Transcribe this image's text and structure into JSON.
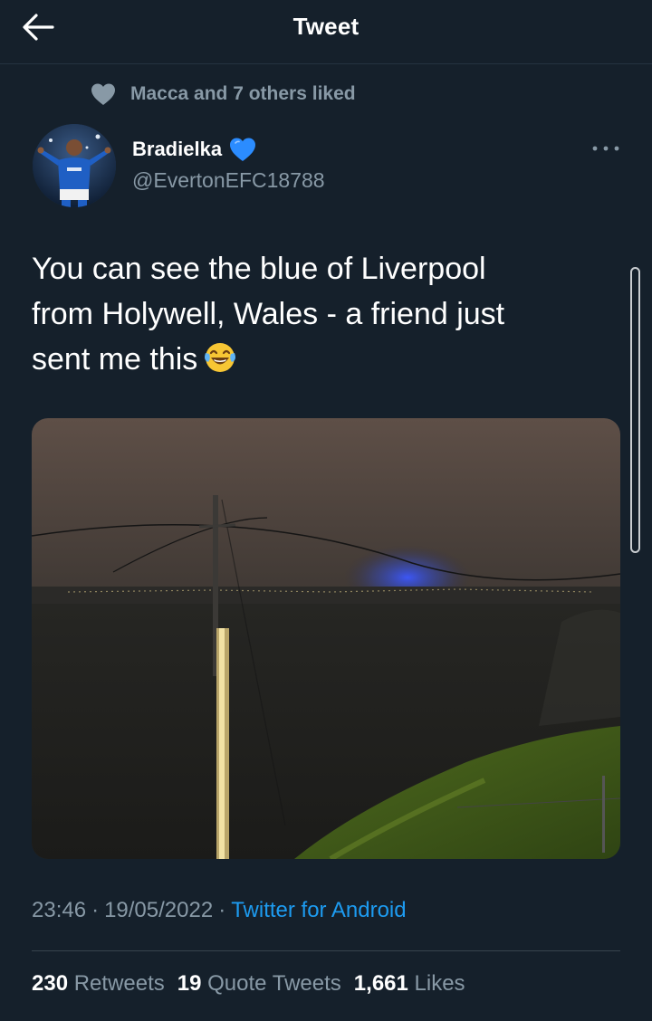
{
  "header": {
    "title": "Tweet",
    "back_icon": "arrow-left-icon"
  },
  "social_context": {
    "icon": "heart-icon",
    "text": "Macca and 7 others liked"
  },
  "tweet": {
    "author": {
      "display_name": "Bradielka",
      "badge_icon": "blue-heart-icon",
      "handle": "@EvertonEFC18788"
    },
    "more_icon": "more-dots-icon",
    "text_lines": [
      "You can see the blue of Liverpool",
      "from Holywell, Wales - a friend just",
      "sent me this"
    ],
    "emoji": "face-with-tears-of-joy-icon",
    "time": "23:46",
    "date": "19/05/2022",
    "separator": "·",
    "source": "Twitter for Android"
  },
  "stats": {
    "retweets_count": "230",
    "retweets_label": "Retweets",
    "quotes_count": "19",
    "quotes_label": "Quote Tweets",
    "likes_count": "1,661",
    "likes_label": "Likes"
  },
  "colors": {
    "background": "#15202b",
    "text_primary": "#ffffff",
    "text_secondary": "#8899a6",
    "link": "#1d9bf0",
    "badge_heart": "#2b8cff"
  }
}
